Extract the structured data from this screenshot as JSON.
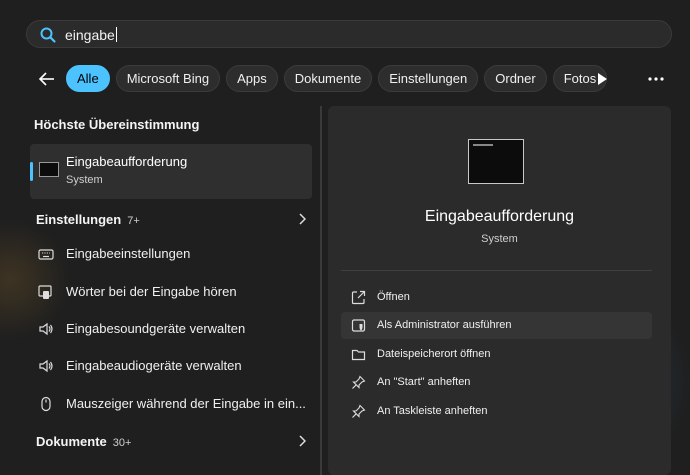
{
  "search": {
    "query": "eingabe"
  },
  "filters": {
    "chips": [
      {
        "label": "Alle",
        "active": true
      },
      {
        "label": "Microsoft Bing",
        "active": false
      },
      {
        "label": "Apps",
        "active": false
      },
      {
        "label": "Dokumente",
        "active": false
      },
      {
        "label": "Einstellungen",
        "active": false
      },
      {
        "label": "Ordner",
        "active": false
      },
      {
        "label": "Fotos",
        "active": false
      }
    ]
  },
  "best_match": {
    "heading": "Höchste Übereinstimmung",
    "title": "Eingabeaufforderung",
    "subtitle": "System"
  },
  "settings_group": {
    "heading": "Einstellungen",
    "count": "7+",
    "items": [
      {
        "label": "Eingabeeinstellungen",
        "icon": "keyboard-icon"
      },
      {
        "label": "Wörter bei der Eingabe hören",
        "icon": "narrator-icon"
      },
      {
        "label": "Eingabesoundgeräte verwalten",
        "icon": "speaker-icon"
      },
      {
        "label": "Eingabeaudiogeräte verwalten",
        "icon": "speaker-icon"
      },
      {
        "label": "Mauszeiger während der Eingabe in ein...",
        "icon": "mouse-icon"
      }
    ]
  },
  "documents_group": {
    "heading": "Dokumente",
    "count": "30+"
  },
  "detail": {
    "title": "Eingabeaufforderung",
    "subtitle": "System",
    "actions": [
      {
        "label": "Öffnen",
        "icon": "open-icon"
      },
      {
        "label": "Als Administrator ausführen",
        "icon": "admin-shield-icon"
      },
      {
        "label": "Dateispeicherort öffnen",
        "icon": "folder-icon"
      },
      {
        "label": "An \"Start\" anheften",
        "icon": "pin-icon"
      },
      {
        "label": "An Taskleiste anheften",
        "icon": "pin-icon"
      }
    ]
  },
  "colors": {
    "accent": "#4cc2ff",
    "background": "#202020",
    "panel": "#2b2b2b"
  }
}
